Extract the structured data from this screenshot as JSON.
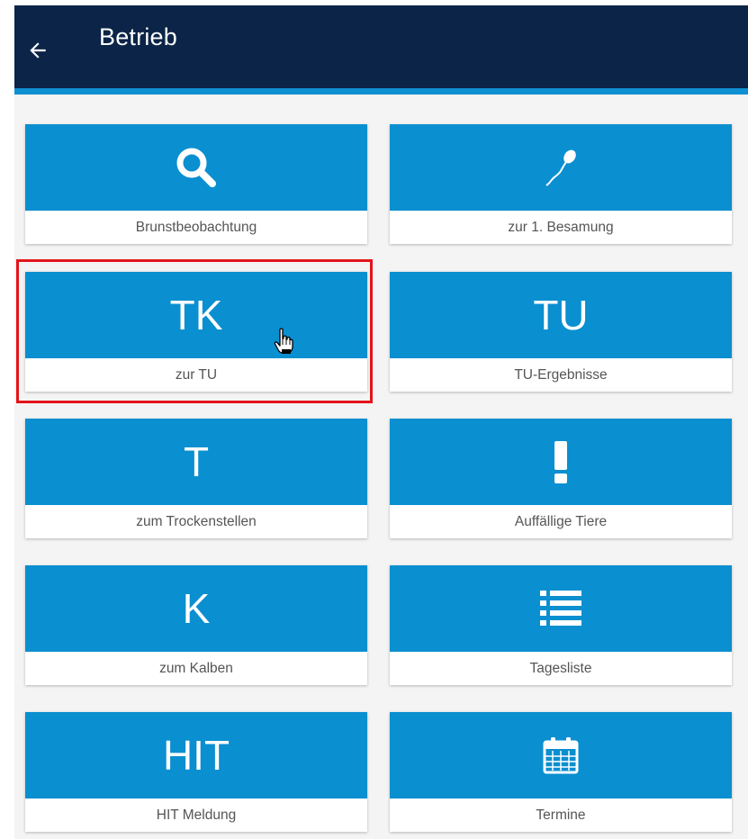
{
  "appbar": {
    "title": "Betrieb",
    "back_icon": "arrow-left-icon"
  },
  "colors": {
    "header_bg": "#0b2447",
    "header_accent": "#0e90d2",
    "tile_bg": "#0a8fd0",
    "highlight": "#e2151b"
  },
  "tiles": [
    {
      "icon": "search-icon",
      "label": "Brunstbeobachtung"
    },
    {
      "icon": "sperm-icon",
      "label": "zur 1. Besamung"
    },
    {
      "icon_text": "TK",
      "label": "zur TU"
    },
    {
      "icon_text": "TU",
      "label": "TU-Ergebnisse"
    },
    {
      "icon_text": "T",
      "label": "zum Trockenstellen"
    },
    {
      "icon": "exclamation-icon",
      "label": "Auffällige Tiere"
    },
    {
      "icon_text": "K",
      "label": "zum Kalben"
    },
    {
      "icon": "list-icon",
      "label": "Tagesliste"
    },
    {
      "icon_text": "HIT",
      "label": "HIT Meldung"
    },
    {
      "icon": "calendar-icon",
      "label": "Termine"
    }
  ]
}
